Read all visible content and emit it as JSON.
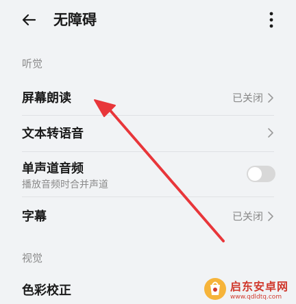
{
  "header": {
    "title": "无障碍",
    "back_icon": "arrow-left-icon",
    "more_icon": "vertical-dots-icon"
  },
  "sections": [
    {
      "label": "听觉",
      "items": [
        {
          "label": "屏幕朗读",
          "status": "已关闭",
          "has_chevron": true
        },
        {
          "label": "文本转语音",
          "status": "",
          "has_chevron": true
        },
        {
          "label": "单声道音频",
          "subtitle": "播放音频时合并声道",
          "toggle": "off"
        },
        {
          "label": "字幕",
          "status": "已关闭",
          "has_chevron": true
        }
      ]
    },
    {
      "label": "视觉",
      "items": [
        {
          "label": "色彩校正"
        }
      ]
    }
  ],
  "annotation": {
    "color": "#e8363a",
    "icon": "red-arrow"
  },
  "watermark": {
    "name": "启东安卓网",
    "url": "www.qdldtq.com",
    "color": "#d0392d"
  }
}
